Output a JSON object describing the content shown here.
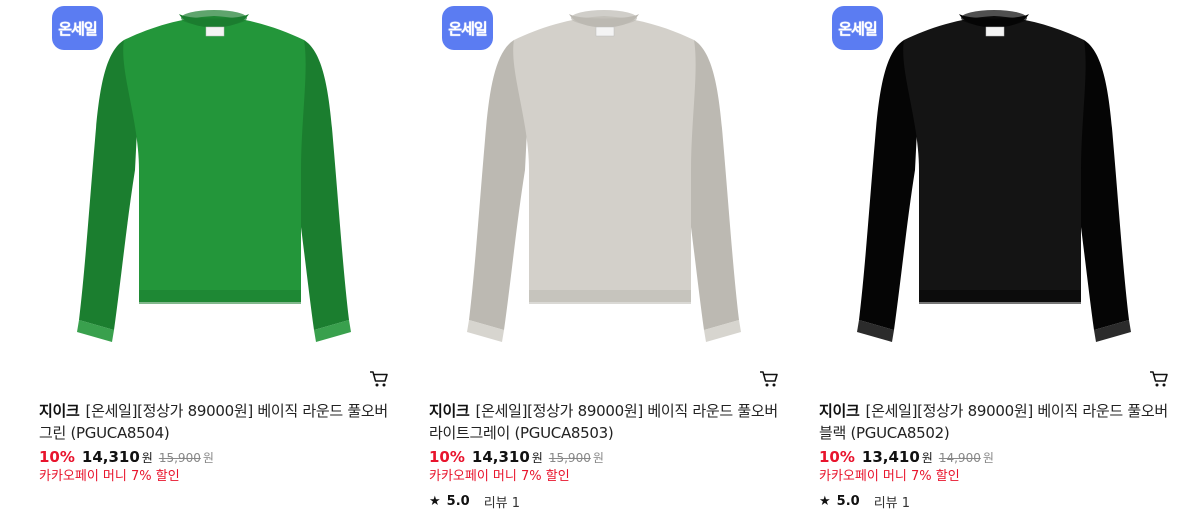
{
  "badge_label": "온세일",
  "products": [
    {
      "brand": "지이크",
      "name": "[온세일][정상가 89000원] 베이직 라운드 풀오버 그린 (PGUCA8504)",
      "discount": "10%",
      "price": "14,310",
      "currency": "원",
      "original_price": "15,900",
      "original_currency": "원",
      "promo": "카카오페이 머니 7% 할인",
      "color": "#23963a",
      "color_shade": "#1b7e2f",
      "rating": null,
      "reviews": null
    },
    {
      "brand": "지이크",
      "name": "[온세일][정상가 89000원] 베이직 라운드 풀오버 라이트그레이 (PGUCA8503)",
      "discount": "10%",
      "price": "14,310",
      "currency": "원",
      "original_price": "15,900",
      "original_currency": "원",
      "promo": "카카오페이 머니 7% 할인",
      "color": "#d3d0ca",
      "color_shade": "#bcb9b2",
      "rating": "5.0",
      "reviews": "리뷰 1"
    },
    {
      "brand": "지이크",
      "name": "[온세일][정상가 89000원] 베이직 라운드 풀오버 블랙 (PGUCA8502)",
      "discount": "10%",
      "price": "13,410",
      "currency": "원",
      "original_price": "14,900",
      "original_currency": "원",
      "promo": "카카오페이 머니 7% 할인",
      "color": "#141414",
      "color_shade": "#050505",
      "rating": "5.0",
      "reviews": "리뷰 1"
    }
  ],
  "icons": {
    "cart": "cart-icon",
    "star": "star-icon"
  }
}
